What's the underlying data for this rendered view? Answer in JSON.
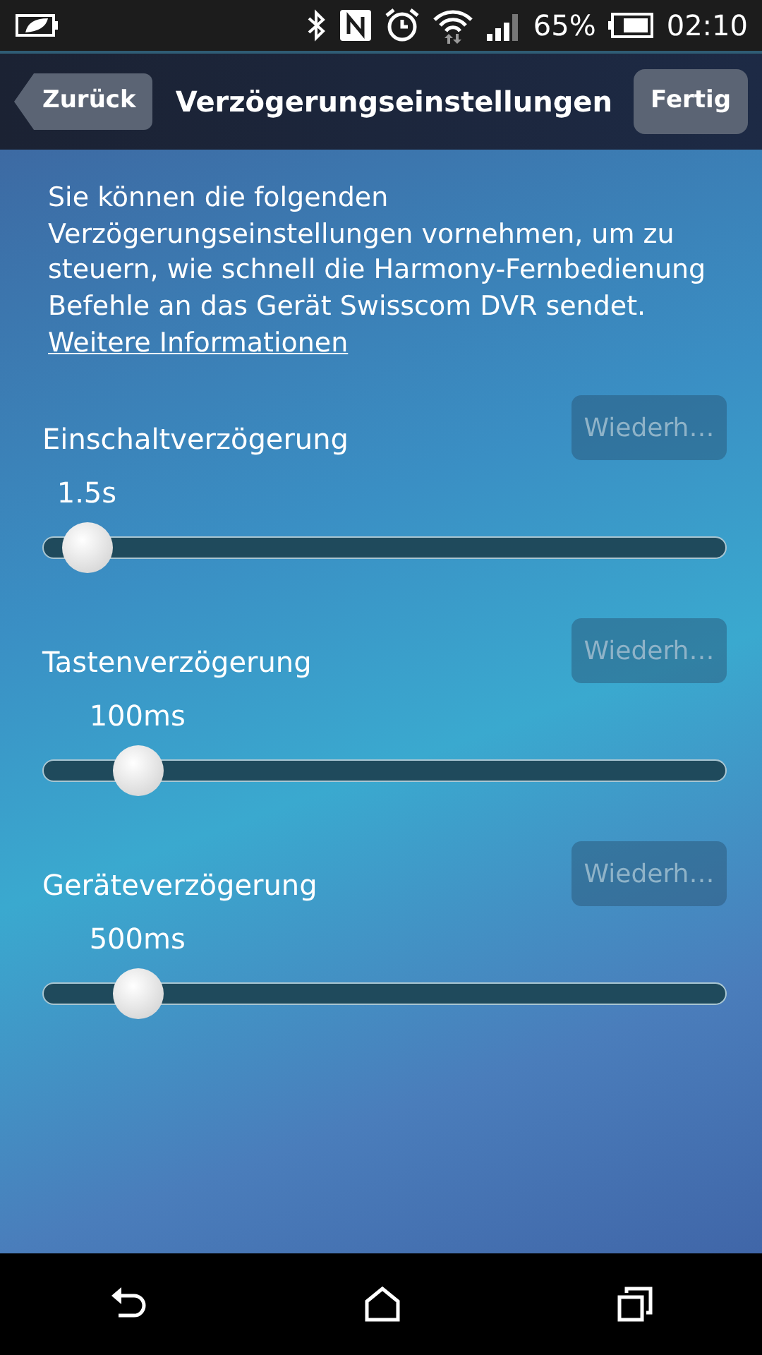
{
  "status_bar": {
    "battery_percent": "65%",
    "time": "02:10"
  },
  "header": {
    "back_button": "Zurück",
    "title": "Verzögerungseinstellungen",
    "done_button": "Fertig"
  },
  "intro": {
    "text": "Sie können die folgenden Verzögerungseinstellungen vornehmen, um zu steuern, wie schnell die Harmony-Fernbedienung Befehle an das Gerät Swisscom DVR sendet.",
    "link": "Weitere Informationen"
  },
  "settings": [
    {
      "label": "Einschaltverzögerung",
      "reset_button": "Wiederh…",
      "reset_disabled": true,
      "value": "1.5s",
      "level": 0.03
    },
    {
      "label": "Tastenverzögerung",
      "reset_button": "Wiederh…",
      "reset_disabled": true,
      "value": "100ms",
      "level": 0.11
    },
    {
      "label": "Geräteverzögerung",
      "reset_button": "Wiederh…",
      "reset_disabled": true,
      "value": "500ms",
      "level": 0.11
    }
  ]
}
